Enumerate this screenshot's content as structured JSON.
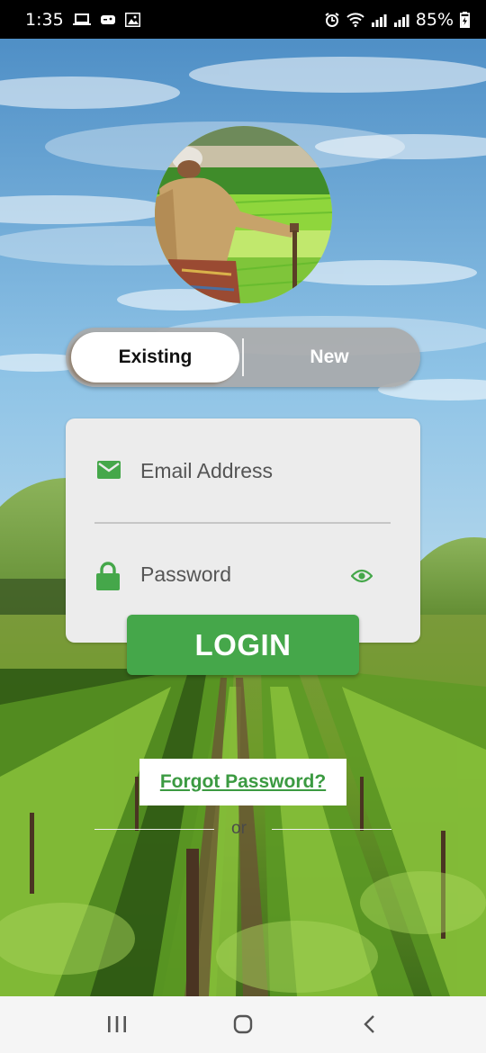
{
  "status_bar": {
    "time": "1:35",
    "battery": "85%",
    "left_icons": [
      "laptop-icon",
      "game-controller-icon",
      "image-icon"
    ],
    "right_icons": [
      "alarm-icon",
      "wifi-icon",
      "signal-icon",
      "signal-r-icon",
      "battery-charging-icon"
    ]
  },
  "login_screen": {
    "toggle": {
      "existing_label": "Existing",
      "new_label": "New",
      "selected": "Existing"
    },
    "email": {
      "placeholder": "Email Address",
      "value": ""
    },
    "password": {
      "placeholder": "Password",
      "value": ""
    },
    "login_label": "LOGIN",
    "forgot_password_label": "Forgot Password?",
    "or_label": "or"
  },
  "nav_bar": {
    "buttons": [
      "recents-icon",
      "home-icon",
      "back-icon"
    ]
  },
  "colors": {
    "brand_green": "#45a74a",
    "link_green": "#3b9a41",
    "card_bg": "#ececec",
    "toggle_bg": "#aaaaaa"
  }
}
